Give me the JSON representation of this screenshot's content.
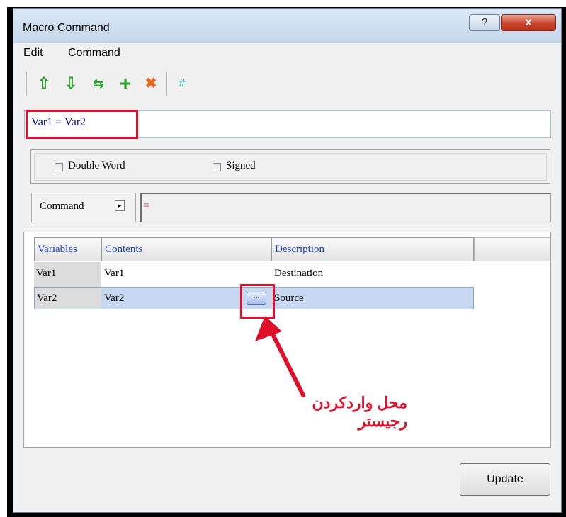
{
  "window": {
    "title": "Macro Command",
    "help_glyph": "?",
    "close_glyph": "x"
  },
  "menu": [
    "Edit",
    "Command"
  ],
  "toolbar": {
    "move_up": "⇧",
    "move_down": "⇩",
    "swap": "⇆",
    "add": "+",
    "delete": "✖",
    "hash": "#"
  },
  "expression": "Var1 = Var2",
  "options": {
    "double_word": "Double Word",
    "signed": "Signed"
  },
  "command": {
    "label": "Command",
    "arrow": "▸",
    "value": "="
  },
  "table": {
    "headers": [
      "Variables",
      "Contents",
      "Description"
    ],
    "rows": [
      {
        "variable": "Var1",
        "contents": "Var1",
        "description": "Destination"
      },
      {
        "variable": "Var2",
        "contents": "Var2",
        "description": "Source"
      }
    ],
    "browse_label": "..."
  },
  "annotation": "محل واردکردن رجیستر",
  "update_label": "Update",
  "colors": {
    "highlight": "#e0102a",
    "header_text": "#1d40c8",
    "selected_row": "#c8d8f0"
  }
}
